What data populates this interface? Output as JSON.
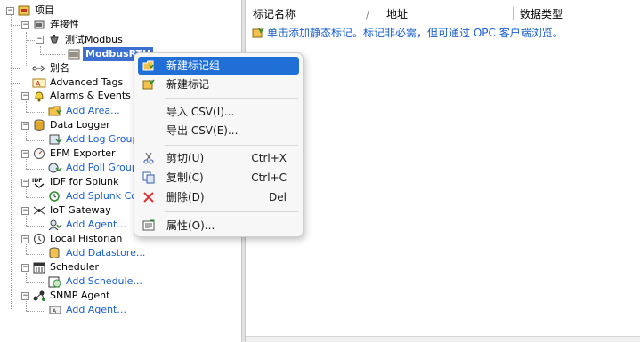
{
  "tree": {
    "root": "项目",
    "connectivity": "连接性",
    "channel": "测试Modbus",
    "device": "ModbusRTU",
    "alias": "别名",
    "advanced_tags": "Advanced Tags",
    "alarms": "Alarms & Events",
    "alarms_add": "Add Area...",
    "data_logger": "Data Logger",
    "data_logger_add": "Add Log Group",
    "efm": "EFM Exporter",
    "efm_add": "Add Poll Group",
    "idf": "IDF for Splunk",
    "idf_add": "Add Splunk Co",
    "iot": "IoT Gateway",
    "iot_add": "Add Agent...",
    "historian": "Local Historian",
    "historian_add": "Add Datastore...",
    "scheduler": "Scheduler",
    "scheduler_add": "Add Schedule...",
    "snmp": "SNMP Agent",
    "snmp_add": "Add Agent..."
  },
  "table": {
    "col_tag_name": "标记名称",
    "col_sep": "/",
    "col_address": "地址",
    "col_data_type": "数据类型",
    "hint": "单击添加静态标记。标记非必需，但可通过 OPC 客户端浏览。"
  },
  "context_menu": {
    "new_tag_group": "新建标记组",
    "new_tag": "新建标记",
    "import_csv": "导入 CSV(I)...",
    "export_csv": "导出 CSV(E)...",
    "cut": "剪切(U)",
    "cut_shortcut": "Ctrl+X",
    "copy": "复制(C)",
    "copy_shortcut": "Ctrl+C",
    "delete": "删除(D)",
    "delete_shortcut": "Del",
    "properties": "属性(O)..."
  },
  "colors": {
    "selection": "#3b6fd2",
    "menu_highlight": "#1f6fd6",
    "link": "#1a5fd0"
  }
}
